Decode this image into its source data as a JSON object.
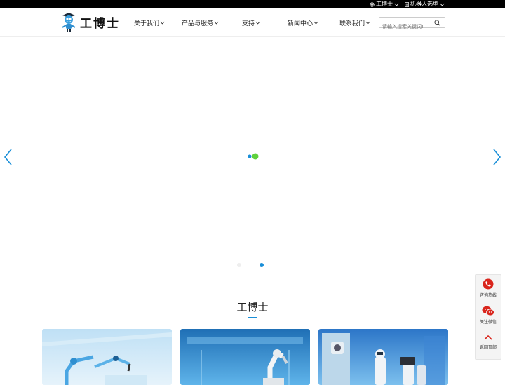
{
  "topbar": {
    "lang_label": "工博士",
    "robot_select_label": "机器人选型"
  },
  "header": {
    "logo_text": "工博士",
    "nav": [
      {
        "label": "关于我们"
      },
      {
        "label": "产品与服务"
      },
      {
        "label": "支持"
      },
      {
        "label": "新闻中心"
      },
      {
        "label": "联系我们"
      }
    ],
    "search_placeholder": "请输入搜索关键词!"
  },
  "banner": {
    "slide_count": 2,
    "active_slide": 2
  },
  "section": {
    "title": "工博士"
  },
  "cards": [
    {
      "icon": "robot-arm-image"
    },
    {
      "icon": "robot-arm-lab-image"
    },
    {
      "icon": "service-robots-image"
    }
  ],
  "sidebar": {
    "hotline_label": "咨询热线",
    "wechat_label": "关注微信",
    "top_label": "返回顶部"
  },
  "colors": {
    "accent": "#1a8fd8",
    "loader_green": "#5fd13c",
    "side_red": "#d9251c"
  }
}
